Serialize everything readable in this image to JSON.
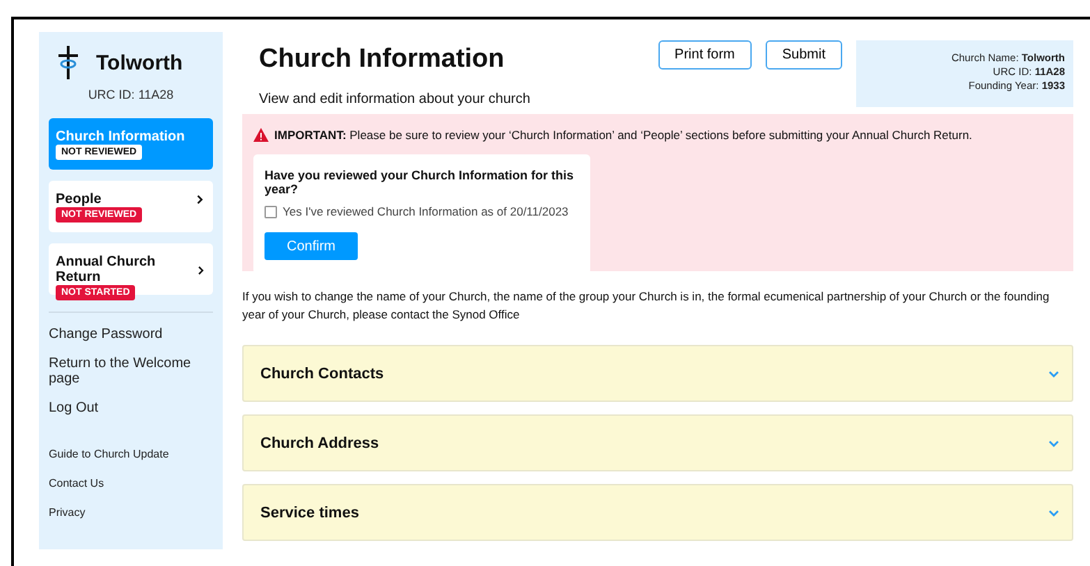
{
  "sidebar": {
    "church_name": "Tolworth",
    "urc_id": "URC ID: 11A28",
    "nav": [
      {
        "label": "Church Information",
        "status": "NOT REVIEWED",
        "selected": true
      },
      {
        "label": "People",
        "status": "NOT REVIEWED",
        "selected": false
      },
      {
        "label": "Annual Church Return",
        "status": "NOT STARTED",
        "selected": false
      }
    ],
    "links": [
      "Change Password",
      "Return to the Welcome page",
      "Log Out"
    ],
    "footer_links": [
      "Guide to Church Update",
      "Contact Us",
      "Privacy"
    ]
  },
  "header": {
    "title": "Church Information",
    "subtitle": "View and edit information about your church",
    "buttons": [
      "Print form",
      "Submit"
    ],
    "info": [
      {
        "label": "Church Name:",
        "value": "Tolworth"
      },
      {
        "label": "URC ID:",
        "value": "11A28"
      },
      {
        "label": "Founding Year:",
        "value": "1933"
      }
    ]
  },
  "alert": {
    "text": "**IMPORTANT:** Please be sure to review your ‘Church Information’ and ‘People’ sections before submitting your Annual Church Return.",
    "question": "Have you reviewed your Church Information for this year?",
    "checkbox": {
      "label": "Yes I've reviewed Church Information as of 20/11/2023",
      "checked": false
    },
    "button": "Confirm"
  },
  "note": "If you wish to change the name of your Church, the name of the group your Church is in, the formal ecumenical partnership of your Church or the founding year of your Church, please contact the Synod Office",
  "sections": [
    {
      "title": "Church Contacts",
      "expanded": false
    },
    {
      "title": "Church Address",
      "expanded": false
    },
    {
      "title": "Service times",
      "expanded": false
    }
  ]
}
